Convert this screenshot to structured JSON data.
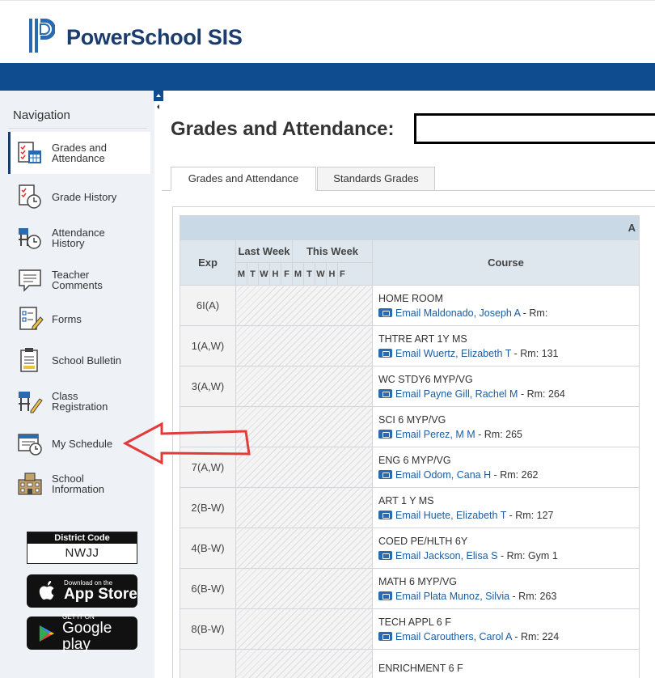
{
  "header": {
    "brand": "PowerSchool SIS",
    "colors": {
      "brand": "#1b3d6e",
      "bar": "#0f4b8f",
      "accent": "#2a6ab0",
      "arrow": "#e23b3b"
    }
  },
  "sidebar": {
    "heading": "Navigation",
    "items": [
      {
        "label": "Grades and\nAttendance",
        "icon": "grades-attendance-icon",
        "active": true
      },
      {
        "label": "Grade History",
        "icon": "grade-history-icon"
      },
      {
        "label": "Attendance\nHistory",
        "icon": "attendance-history-icon"
      },
      {
        "label": "Teacher\nComments",
        "icon": "teacher-comments-icon"
      },
      {
        "label": "Forms",
        "icon": "forms-icon"
      },
      {
        "label": "School Bulletin",
        "icon": "school-bulletin-icon"
      },
      {
        "label": "Class\nRegistration",
        "icon": "class-registration-icon"
      },
      {
        "label": "My Schedule",
        "icon": "my-schedule-icon"
      },
      {
        "label": "School\nInformation",
        "icon": "school-information-icon"
      }
    ],
    "district": {
      "title": "District Code",
      "code": "NWJJ"
    },
    "app_store": {
      "small": "Download on the",
      "big": "App Store"
    },
    "google_play": {
      "small": "GET IT ON",
      "big": "Google play"
    }
  },
  "main": {
    "title": "Grades and Attendance:",
    "tabs": [
      {
        "label": "Grades and Attendance",
        "active": true
      },
      {
        "label": "Standards Grades"
      }
    ],
    "table": {
      "band_label": "A",
      "headers": {
        "exp": "Exp",
        "last_week": "Last Week",
        "this_week": "This Week",
        "course": "Course"
      },
      "days": [
        "M",
        "T",
        "W",
        "H",
        "F",
        "M",
        "T",
        "W",
        "H",
        "F"
      ],
      "email_label": "Email",
      "rows": [
        {
          "exp": "6I(A)",
          "course": "HOME ROOM",
          "teacher": "Maldonado, Joseph A",
          "room": " - Rm:"
        },
        {
          "exp": "1(A,W)",
          "course": "THTRE ART 1Y MS",
          "teacher": "Wuertz, Elizabeth T",
          "room": " - Rm: 131"
        },
        {
          "exp": "3(A,W)",
          "course": "WC STDY6 MYP/VG",
          "teacher": "Payne Gill, Rachel M",
          "room": " - Rm: 264"
        },
        {
          "exp": "",
          "course": "SCI 6 MYP/VG",
          "teacher": "Perez, M M",
          "room": " - Rm: 265"
        },
        {
          "exp": "7(A,W)",
          "course": "ENG 6 MYP/VG",
          "teacher": "Odom, Cana H",
          "room": " - Rm: 262"
        },
        {
          "exp": "2(B-W)",
          "course": "ART 1 Y MS",
          "teacher": "Huete, Elizabeth T",
          "room": " - Rm: 127"
        },
        {
          "exp": "4(B-W)",
          "course": "COED PE/HLTH 6Y",
          "teacher": "Jackson, Elisa S",
          "room": " - Rm: Gym 1"
        },
        {
          "exp": "6(B-W)",
          "course": "MATH 6 MYP/VG",
          "teacher": "Plata Munoz, Silvia",
          "room": " - Rm: 263"
        },
        {
          "exp": "8(B-W)",
          "course": "TECH APPL 6 F",
          "teacher": "Carouthers, Carol A",
          "room": " - Rm: 224"
        },
        {
          "exp": "",
          "course": "ENRICHMENT 6 F",
          "teacher": "",
          "room": ""
        }
      ]
    }
  }
}
